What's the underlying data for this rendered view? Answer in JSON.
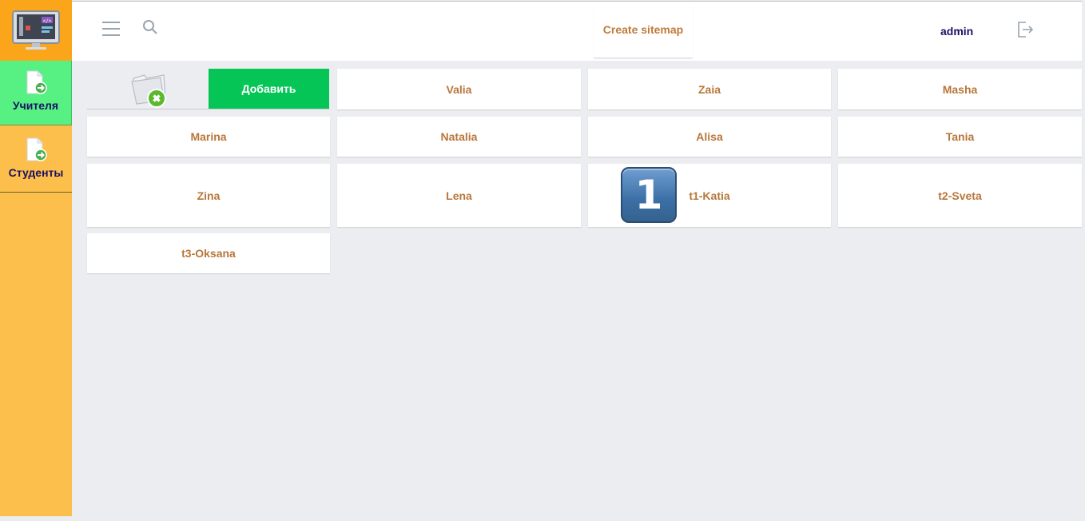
{
  "sidebar": {
    "items": [
      {
        "label": "Учителя",
        "icon": "document-arrow-icon",
        "active": true
      },
      {
        "label": "Студенты",
        "icon": "document-arrow-icon",
        "active": false
      }
    ]
  },
  "header": {
    "sitemap_label": "Create sitemap",
    "user_label": "admin"
  },
  "toolbar": {
    "add_label": "Добавить"
  },
  "cards": [
    {
      "name": "Valia"
    },
    {
      "name": "Zaia"
    },
    {
      "name": "Masha"
    },
    {
      "name": "Marina"
    },
    {
      "name": "Natalia"
    },
    {
      "name": "Alisa"
    },
    {
      "name": "Tania"
    },
    {
      "name": "Zina"
    },
    {
      "name": "Lena"
    },
    {
      "name": "t1-Katia"
    },
    {
      "name": "t2-Sveta"
    },
    {
      "name": "t3-Oksana"
    }
  ],
  "badge": {
    "text": "1"
  },
  "colors": {
    "accent_green": "#06c557",
    "sidebar_bg": "#fdbf4b",
    "active_item": "#57f083",
    "card_text": "#b8763a",
    "nav_text": "#1a1064"
  }
}
